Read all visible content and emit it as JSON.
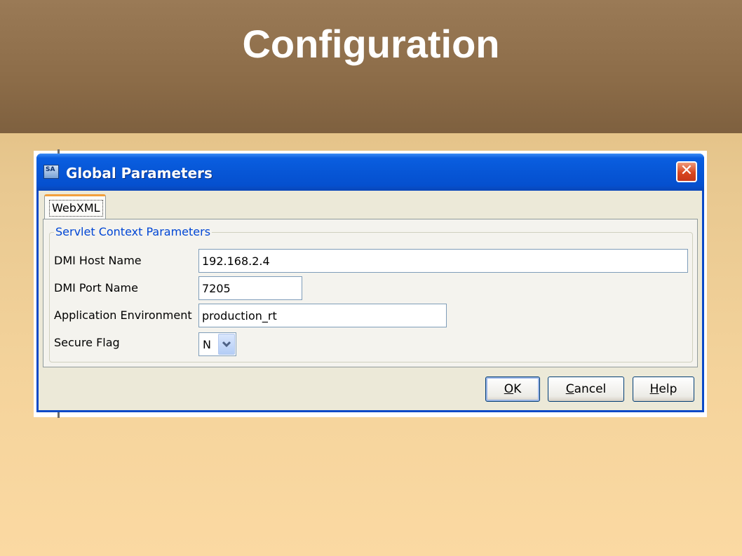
{
  "slide": {
    "title": "Configuration"
  },
  "window": {
    "title": "Global Parameters",
    "icon": "SA",
    "close_glyph": "✕"
  },
  "tabs": [
    {
      "label": "WebXML",
      "selected": true
    }
  ],
  "group": {
    "legend": "Servlet Context Parameters"
  },
  "fields": {
    "dmi_host": {
      "label": "DMI Host Name",
      "value": "192.168.2.4"
    },
    "dmi_port": {
      "label": "DMI Port Name",
      "value": "7205"
    },
    "app_env": {
      "label": "Application Environment",
      "value": "production_rt"
    },
    "secure_flag": {
      "label": "Secure Flag",
      "value": "N"
    }
  },
  "buttons": {
    "ok": {
      "label_first": "O",
      "label_rest": "K"
    },
    "cancel": {
      "label_first": "C",
      "label_rest": "ancel"
    },
    "help": {
      "label_first": "H",
      "label_rest": "elp"
    }
  },
  "colors": {
    "title_bar": "#0756d6",
    "legend_text": "#0046d5",
    "close_button": "#d9461e",
    "header_band": "#8c6c48"
  }
}
